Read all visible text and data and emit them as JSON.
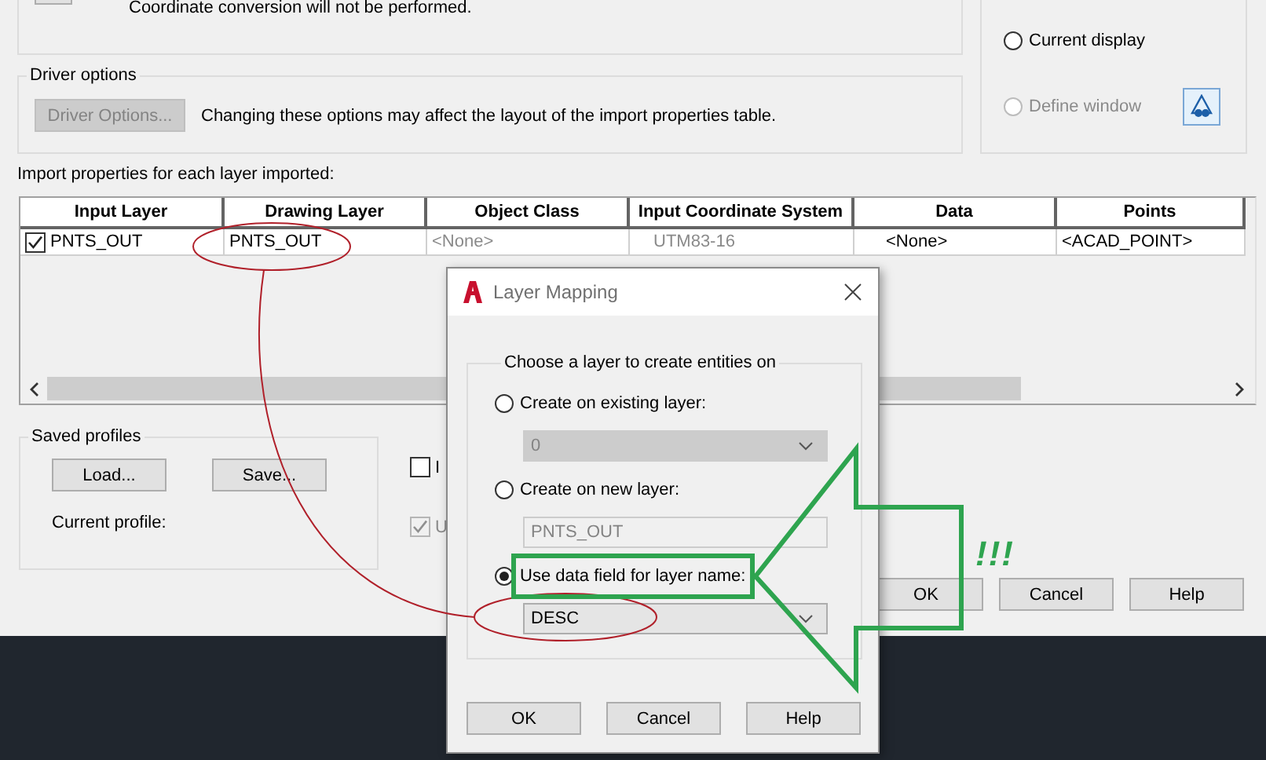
{
  "dialog": {
    "conversion_note": "Coordinate conversion will not be performed.",
    "display_options": [
      {
        "label": "Current display",
        "selected": false,
        "disabled": false
      },
      {
        "label": "Define window",
        "selected": false,
        "disabled": true
      }
    ],
    "driver_options": {
      "title": "Driver options",
      "button": "Driver Options...",
      "button_disabled": true,
      "note": "Changing these options may affect the layout of the import properties table."
    },
    "import_properties": {
      "label": "Import properties for each layer imported:",
      "columns": [
        "Input Layer",
        "Drawing Layer",
        "Object Class",
        "Input Coordinate System",
        "Data",
        "Points"
      ],
      "rows": [
        {
          "checked": true,
          "cells": [
            {
              "text": "PNTS_OUT",
              "dimmed": false
            },
            {
              "text": "PNTS_OUT",
              "dimmed": false
            },
            {
              "text": "<None>",
              "dimmed": true
            },
            {
              "text": "UTM83-16",
              "dimmed": true
            },
            {
              "text": "<None>",
              "dimmed": false
            },
            {
              "text": "<ACAD_POINT>",
              "dimmed": false
            }
          ]
        }
      ]
    },
    "saved_profiles": {
      "title": "Saved profiles",
      "buttons": [
        "Load...",
        "Save..."
      ],
      "current_profile_label": "Current profile:"
    },
    "options": [
      {
        "label": "I",
        "checked": false,
        "disabled": false
      },
      {
        "label": "U",
        "checked": true,
        "disabled": true
      }
    ],
    "buttons": [
      "OK",
      "Cancel",
      "Help"
    ]
  },
  "layer_mapping": {
    "title": "Layer Mapping",
    "group_title": "Choose a layer to create entities on",
    "choices": [
      {
        "label": "Create on existing layer:",
        "selected": false,
        "kind": "dropdown",
        "value": "0",
        "disabled": true
      },
      {
        "label": "Create on new layer:",
        "selected": false,
        "kind": "field",
        "value": "PNTS_OUT",
        "disabled": true
      },
      {
        "label": "Use data field for layer name:",
        "selected": true,
        "kind": "dropdown",
        "value": "DESC",
        "disabled": false
      }
    ],
    "buttons": [
      "OK",
      "Cancel",
      "Help"
    ]
  },
  "annotation": {
    "exclamation": "!!!"
  }
}
